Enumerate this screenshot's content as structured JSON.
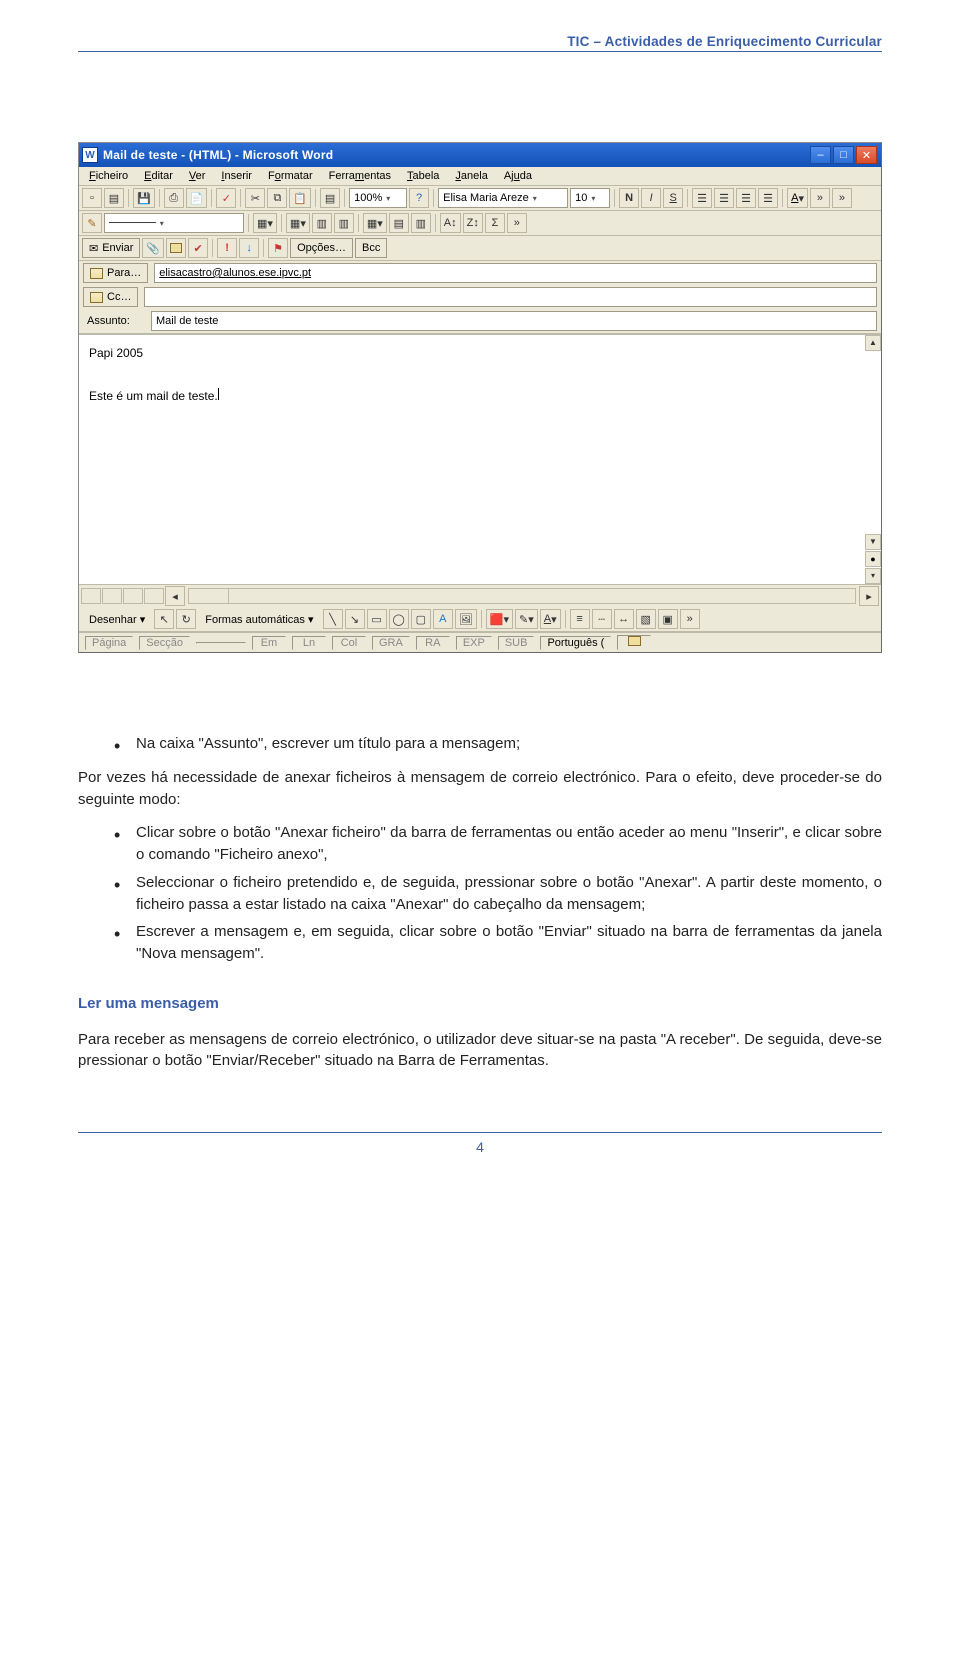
{
  "header_text": "TIC – Actividades de Enriquecimento Curricular",
  "word": {
    "title": "Mail de teste - (HTML) - Microsoft Word",
    "menus": [
      "Ficheiro",
      "Editar",
      "Ver",
      "Inserir",
      "Formatar",
      "Ferramentas",
      "Tabela",
      "Janela",
      "Ajuda"
    ],
    "zoom": "100%",
    "font_name": "Elisa Maria Areze",
    "font_size": "10",
    "send_label": "Enviar",
    "opcoes_label": "Opções…",
    "bcc_label": "Bcc",
    "para_label": "Para…",
    "cc_label": "Cc…",
    "assunto_label": "Assunto:",
    "para_value": "elisacastro@alunos.ese.ipvc.pt",
    "cc_value": "",
    "assunto_value": "Mail de teste",
    "body_line1": "Papi 2005",
    "body_line2": "Este é um mail de teste.",
    "draw_label": "Desenhar",
    "formas_label": "Formas automáticas",
    "status_cells": [
      "Página",
      "Secção",
      "",
      "Em",
      "Ln",
      "Col",
      "GRA",
      "RA",
      "EXP",
      "SUB"
    ],
    "status_lang": "Português ("
  },
  "doc": {
    "b1": "Na caixa \"Assunto\", escrever um título para a mensagem;",
    "p1": "Por vezes há necessidade de anexar ficheiros à mensagem de correio electrónico. Para o efeito, deve proceder-se do seguinte modo:",
    "sub1": "Clicar sobre o botão \"Anexar ficheiro\" da barra de ferramentas ou então aceder ao menu \"Inserir\", e clicar sobre o comando \"Ficheiro anexo\",",
    "sub2": "Seleccionar o ficheiro pretendido e, de seguida, pressionar sobre o botão \"Anexar\". A partir deste momento, o ficheiro passa a estar listado na caixa \"Anexar\" do cabeçalho da mensagem;",
    "sub3": "Escrever a mensagem e, em seguida, clicar sobre o botão \"Enviar\" situado na barra de ferramentas da janela \"Nova mensagem\".",
    "heading": "Ler uma mensagem",
    "p2": "Para receber as mensagens de correio electrónico, o utilizador deve situar-se na pasta \"A receber\". De seguida, deve-se pressionar o botão \"Enviar/Receber\" situado na Barra de Ferramentas.",
    "page_no": "4"
  }
}
